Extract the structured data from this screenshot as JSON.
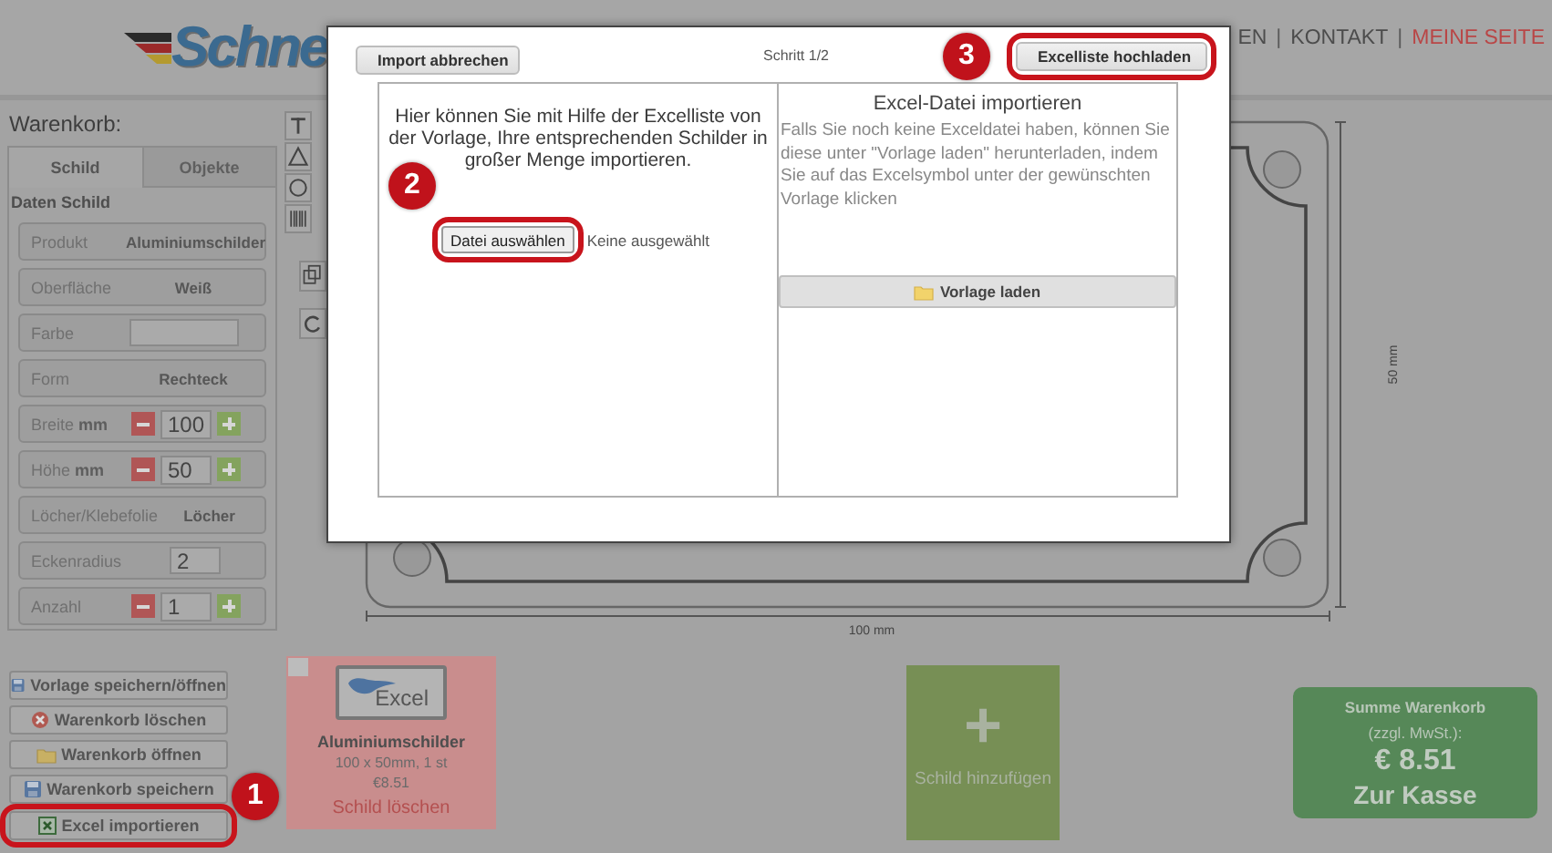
{
  "header": {
    "logo": "Schne",
    "nav": [
      {
        "kind": "link",
        "label": "EN",
        "active": false
      },
      {
        "kind": "separator",
        "label": "|"
      },
      {
        "kind": "link",
        "label": "KONTAKT",
        "active": false
      },
      {
        "kind": "separator",
        "label": "|"
      },
      {
        "kind": "link",
        "label": "MEINE SEITE",
        "active": true
      }
    ]
  },
  "cart": {
    "title": "Warenkorb:",
    "tabs": [
      {
        "label": "Schild",
        "selected": true
      },
      {
        "label": "Objekte",
        "selected": false
      }
    ],
    "section": "Daten Schild",
    "rows": [
      {
        "kind": "value",
        "label": "Produkt",
        "value": "Aluminiumschilder"
      },
      {
        "kind": "value",
        "label": "Oberfläche",
        "value": "Weiß"
      },
      {
        "kind": "field",
        "label": "Farbe"
      },
      {
        "kind": "value",
        "label": "Form",
        "value": "Rechteck"
      },
      {
        "kind": "stepper",
        "label": "Breite **mm**",
        "value": "100"
      },
      {
        "kind": "stepper",
        "label": "Höhe **mm**",
        "value": "50"
      },
      {
        "kind": "value",
        "label": "Löcher/Klebefolie",
        "value": "Löcher"
      },
      {
        "kind": "field",
        "label": "Eckenradius",
        "value": "2"
      },
      {
        "kind": "stepper",
        "label": "Anzahl",
        "value": "1"
      }
    ]
  },
  "canvas": {
    "width_label": "100 mm",
    "height_label": "50 mm"
  },
  "actions": [
    {
      "label": "Vorlage speichern/öffnen",
      "kind": "save",
      "highlighted": false
    },
    {
      "label": "Warenkorb löschen",
      "kind": "delete",
      "highlighted": false
    },
    {
      "label": "Warenkorb öffnen",
      "kind": "open",
      "highlighted": false
    },
    {
      "label": "Warenkorb speichern",
      "kind": "save",
      "highlighted": false
    },
    {
      "label": "Excel importieren",
      "kind": "import",
      "highlighted": true,
      "callout": "1"
    }
  ],
  "cart_items": [
    {
      "thumbnail_text": "Excel",
      "product": "Aluminiumschilder",
      "details": "100 x 50mm, 1 st",
      "price": "€8.51",
      "delete": "Schild löschen"
    }
  ],
  "add_item": {
    "symbol": "+",
    "label": "Schild hinzufügen"
  },
  "total": {
    "title": "Summe Warenkorb",
    "note": "(zzgl. MwSt.):",
    "amount": "€ 8.51",
    "checkout": "Zur Kasse"
  },
  "dialog": {
    "cancel_button": {
      "label": "Import abbrechen"
    },
    "step": "Schritt 1/2",
    "upload_button": {
      "label": "Excelliste hochladen",
      "highlighted": true,
      "callout": "3"
    },
    "left_panel": {
      "text": "Hier können Sie mit Hilfe der Excelliste von der Vorlage, Ihre entsprechenden Schilder in großer Menge importieren.",
      "file_button": {
        "label": "Datei auswählen",
        "highlighted": true,
        "callout": "2"
      },
      "file_status": "Keine ausgewählt"
    },
    "right_panel": {
      "title": "Excel-Datei importieren",
      "text": "Falls Sie noch keine Exceldatei haben, können Sie diese unter \"Vorlage laden\" herunterladen, indem Sie auf das Excelsymbol unter der gewünschten Vorlage klicken",
      "template_button": "Vorlage laden"
    }
  }
}
